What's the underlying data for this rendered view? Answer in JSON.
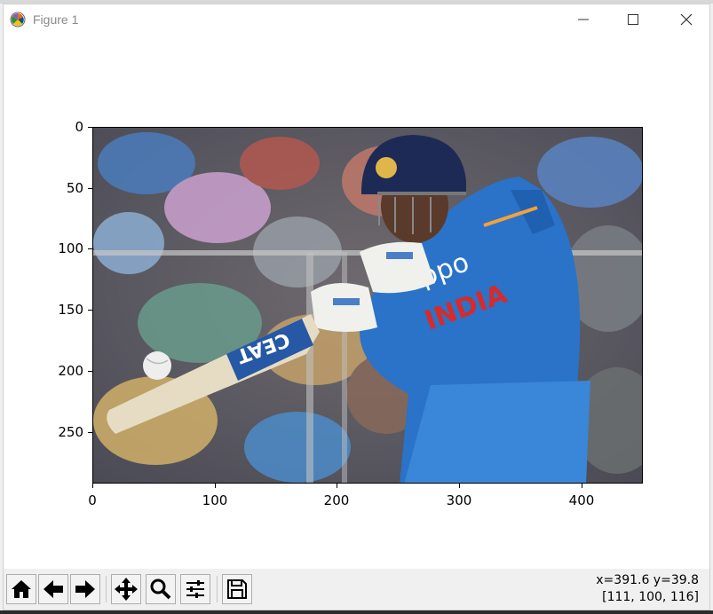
{
  "window": {
    "title": "Figure 1"
  },
  "axes": {
    "yticks": [
      "0",
      "50",
      "100",
      "150",
      "200",
      "250"
    ],
    "xticks": [
      "0",
      "100",
      "200",
      "300",
      "400"
    ]
  },
  "image": {
    "sponsor_text": "oppo",
    "country_text": "INDIA",
    "bat_brand": "CEAT"
  },
  "status": {
    "coords": "x=391.6 y=39.8",
    "pixel": "[111, 100, 116]"
  },
  "toolbar": {
    "buttons": [
      "home-icon",
      "back-icon",
      "forward-icon",
      "pan-icon",
      "zoom-icon",
      "configure-icon",
      "save-icon"
    ]
  }
}
